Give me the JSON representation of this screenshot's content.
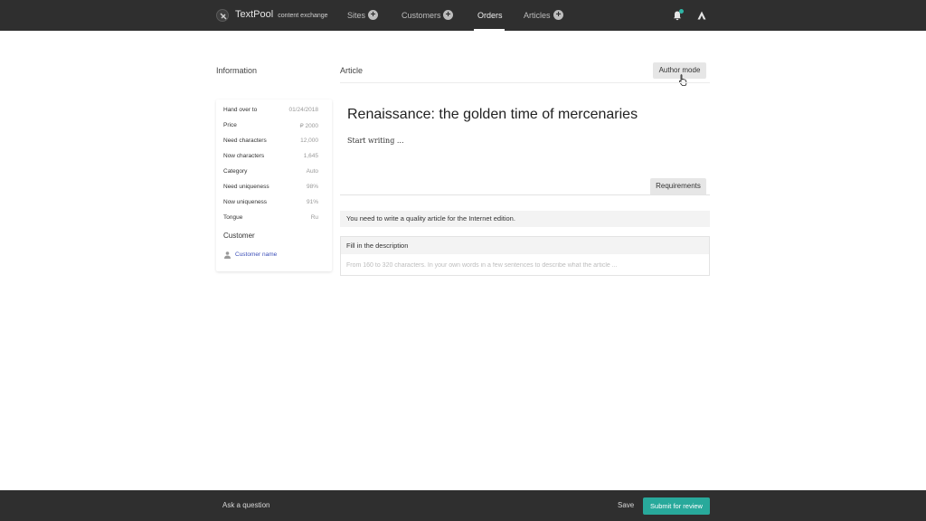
{
  "app": {
    "name": "TextPool",
    "tagline": "content exchange"
  },
  "nav": {
    "items": [
      {
        "label": "Sites",
        "has_add": true
      },
      {
        "label": "Customers",
        "has_add": true
      },
      {
        "label": "Orders",
        "active": true
      },
      {
        "label": "Articles",
        "has_add": true
      }
    ],
    "icons": [
      "logo-icon",
      "plus-circle-icon",
      "bell-icon",
      "brand-a-icon"
    ],
    "notification_dot_color": "#2fb5a6"
  },
  "sections": {
    "information": "Information",
    "article": "Article"
  },
  "author_mode_label": "Author mode",
  "info": {
    "rows": [
      {
        "label": "Hand over to",
        "value": "01/24/2018"
      },
      {
        "label": "Price",
        "value": "₽ 2000"
      },
      {
        "label": "Need characters",
        "value": "12,000"
      },
      {
        "label": "Now characters",
        "value": "1,645"
      },
      {
        "label": "Category",
        "value": "Auto"
      },
      {
        "label": "Need uniqueness",
        "value": "98%"
      },
      {
        "label": "Now uniqueness",
        "value": "91%"
      },
      {
        "label": "Tongue",
        "value": "Ru"
      }
    ],
    "customer_title": "Customer",
    "customer_name": "Customer name"
  },
  "article": {
    "title": "Renaissance: the golden time of mercenaries",
    "body_placeholder": "Start writing ...",
    "requirements_tab": "Requirements",
    "notice": "You need to write a quality article for the Internet edition.",
    "description_label": "Fill in the description",
    "description_placeholder": "From 160 to 320 characters. In your own words in a few sentences to describe what the article ..."
  },
  "footer": {
    "ask": "Ask a question",
    "save": "Save",
    "submit": "Submit for review",
    "submit_color": "#28a99b"
  }
}
